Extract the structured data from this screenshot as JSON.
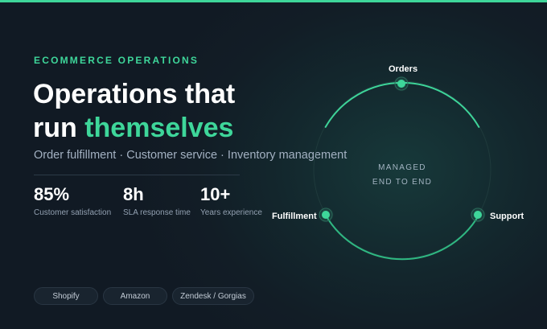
{
  "hero": {
    "eyebrow": "ECOMMERCE OPERATIONS",
    "headline_line1": "Operations that",
    "headline_line2_prefix": "run ",
    "headline_line2_accent": "themselves",
    "subline": "Order fulfillment · Customer service · Inventory management"
  },
  "stats": [
    {
      "value": "85%",
      "label": "Customer satisfaction"
    },
    {
      "value": "8h",
      "label": "SLA response time"
    },
    {
      "value": "10+",
      "label": "Years experience"
    }
  ],
  "platforms": [
    "Shopify",
    "Amazon",
    "Zendesk / Gorgias"
  ],
  "diagram": {
    "center_line1": "MANAGED",
    "center_line2": "END TO END",
    "nodes": {
      "top": "Orders",
      "left": "Fulfillment",
      "right": "Support"
    }
  },
  "colors": {
    "accent": "#3ed69a",
    "background": "#121d26",
    "muted_text": "#a3b1c2"
  }
}
